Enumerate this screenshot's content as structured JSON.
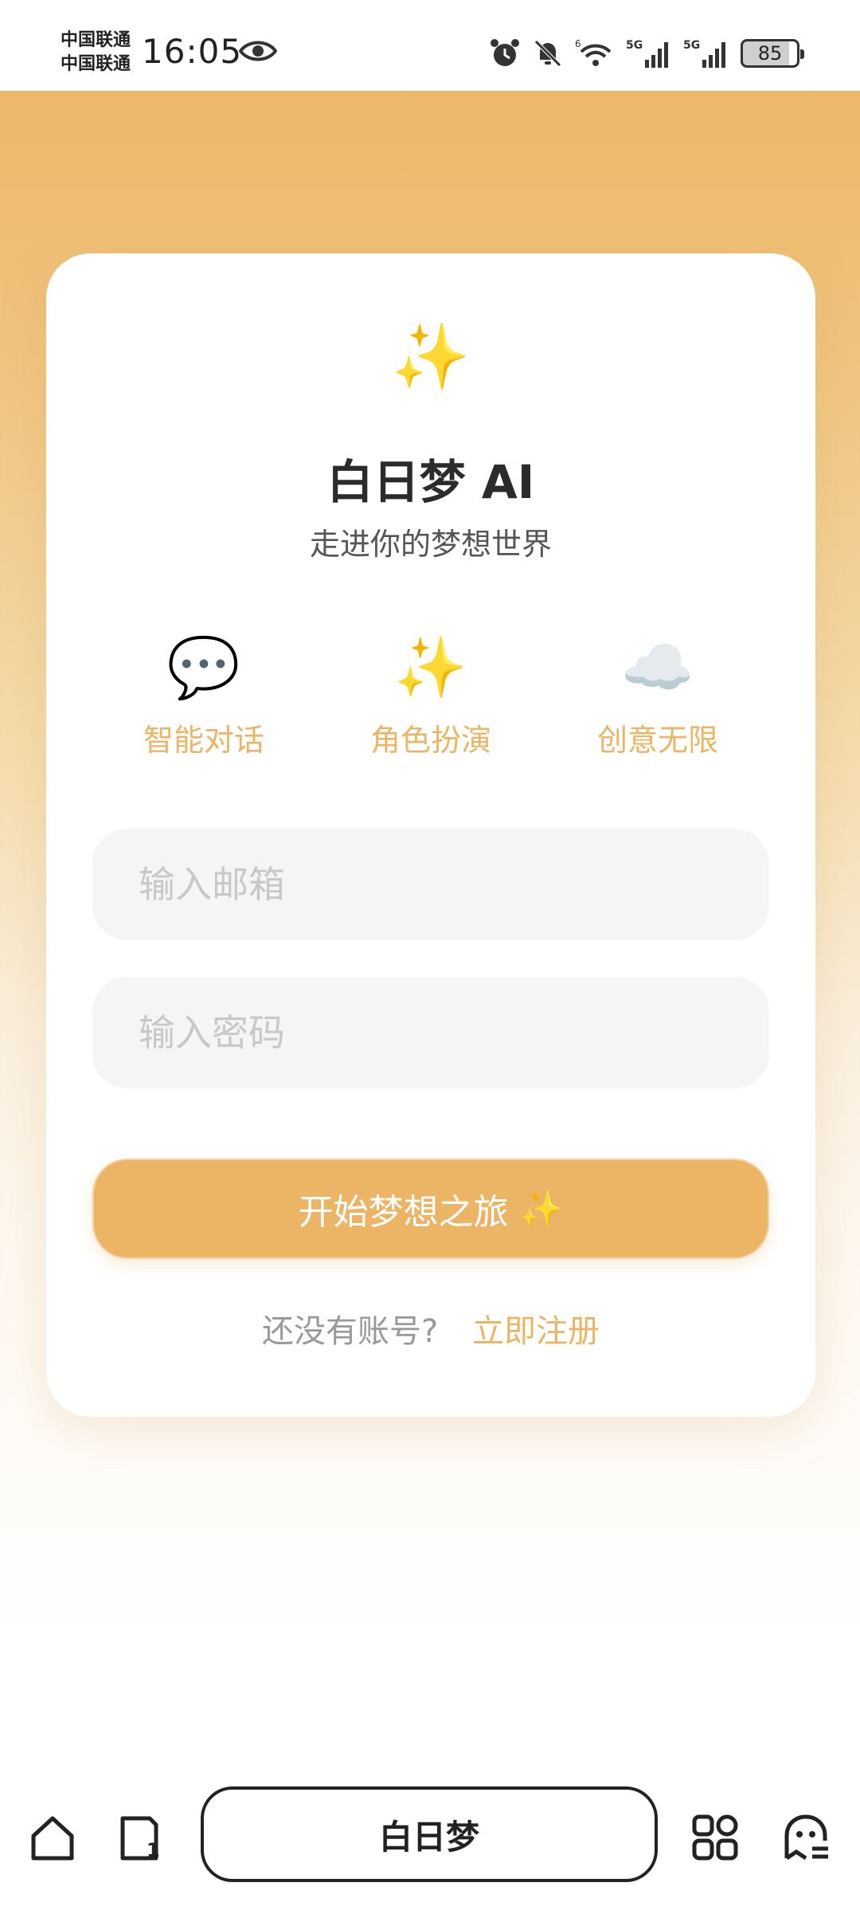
{
  "status_bar": {
    "carrier_1": "中国联通",
    "carrier_2": "中国联通",
    "time": "16:05",
    "battery": "85"
  },
  "card": {
    "logo_icon": "sparkles-icon",
    "logo_glyph": "✨",
    "title": "白日梦 AI",
    "subtitle": "走进你的梦想世界",
    "features": [
      {
        "icon": "speech-bubble-icon",
        "glyph": "💬",
        "label": "智能对话"
      },
      {
        "icon": "sparkles-icon",
        "glyph": "✨",
        "label": "角色扮演"
      },
      {
        "icon": "cloud-icon",
        "glyph": "☁️",
        "label": "创意无限"
      }
    ],
    "email_placeholder": "输入邮箱",
    "password_placeholder": "输入密码",
    "submit_label": "开始梦想之旅",
    "submit_glyph": "✨",
    "register_prompt": "还没有账号?",
    "register_link": "立即注册"
  },
  "browser_bar": {
    "url_title": "白日梦"
  },
  "colors": {
    "accent": "#ecb566",
    "gradient_top": "#ecb769",
    "gradient_bottom": "#ffffff",
    "text_primary": "#2b2b2b",
    "input_bg": "#f5f5f5"
  }
}
